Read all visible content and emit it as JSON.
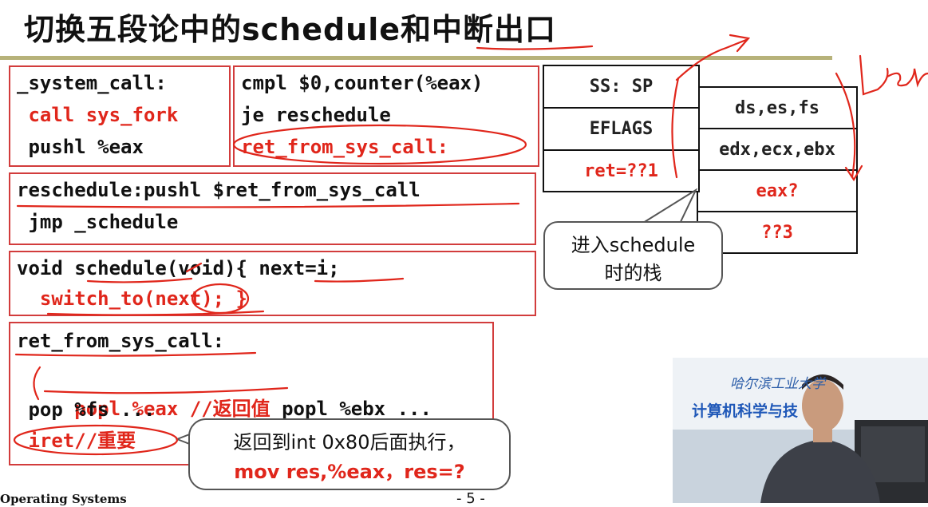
{
  "slide": {
    "title": "切换五段论中的schedule和中断出口",
    "footer_left": "Operating Systems",
    "page": "- 5 -"
  },
  "code_boxes": {
    "box1": [
      "_system_call:",
      " call sys_fork",
      " pushl %eax"
    ],
    "box2": [
      "cmpl $0,counter(%eax)",
      "je reschedule",
      "ret_from_sys_call:"
    ],
    "box3": [
      "reschedule:pushl $ret_from_sys_call",
      " jmp _schedule"
    ],
    "box4": [
      "void schedule(void){ next=i;",
      "  switch_to(next); }"
    ],
    "box5": {
      "line1": "ret_from_sys_call:",
      "line2_red": " popl %eax //返回值",
      "line2_rest": " popl %ebx ...",
      "line3": " pop %fs ...",
      "line4_red": " iret//重要"
    }
  },
  "stack_left": [
    "SS: SP",
    "EFLAGS",
    "ret=??1"
  ],
  "stack_right": [
    "ds,es,fs",
    "edx,ecx,ebx",
    "eax?",
    "??3"
  ],
  "callout_stack": {
    "line1": "进入schedule",
    "line2": "时的栈"
  },
  "callout_iret": {
    "line1": "返回到int 0x80后面执行，",
    "line2": "mov res,%eax，res=?"
  },
  "video": {
    "banner_line1": "哈尔滨工业大学",
    "banner_line2": "计算机科学与技"
  },
  "annotation_text": "user",
  "colors": {
    "accent_red": "#e0261b",
    "rule": "#b7b27a",
    "ink": "#e0261b"
  }
}
